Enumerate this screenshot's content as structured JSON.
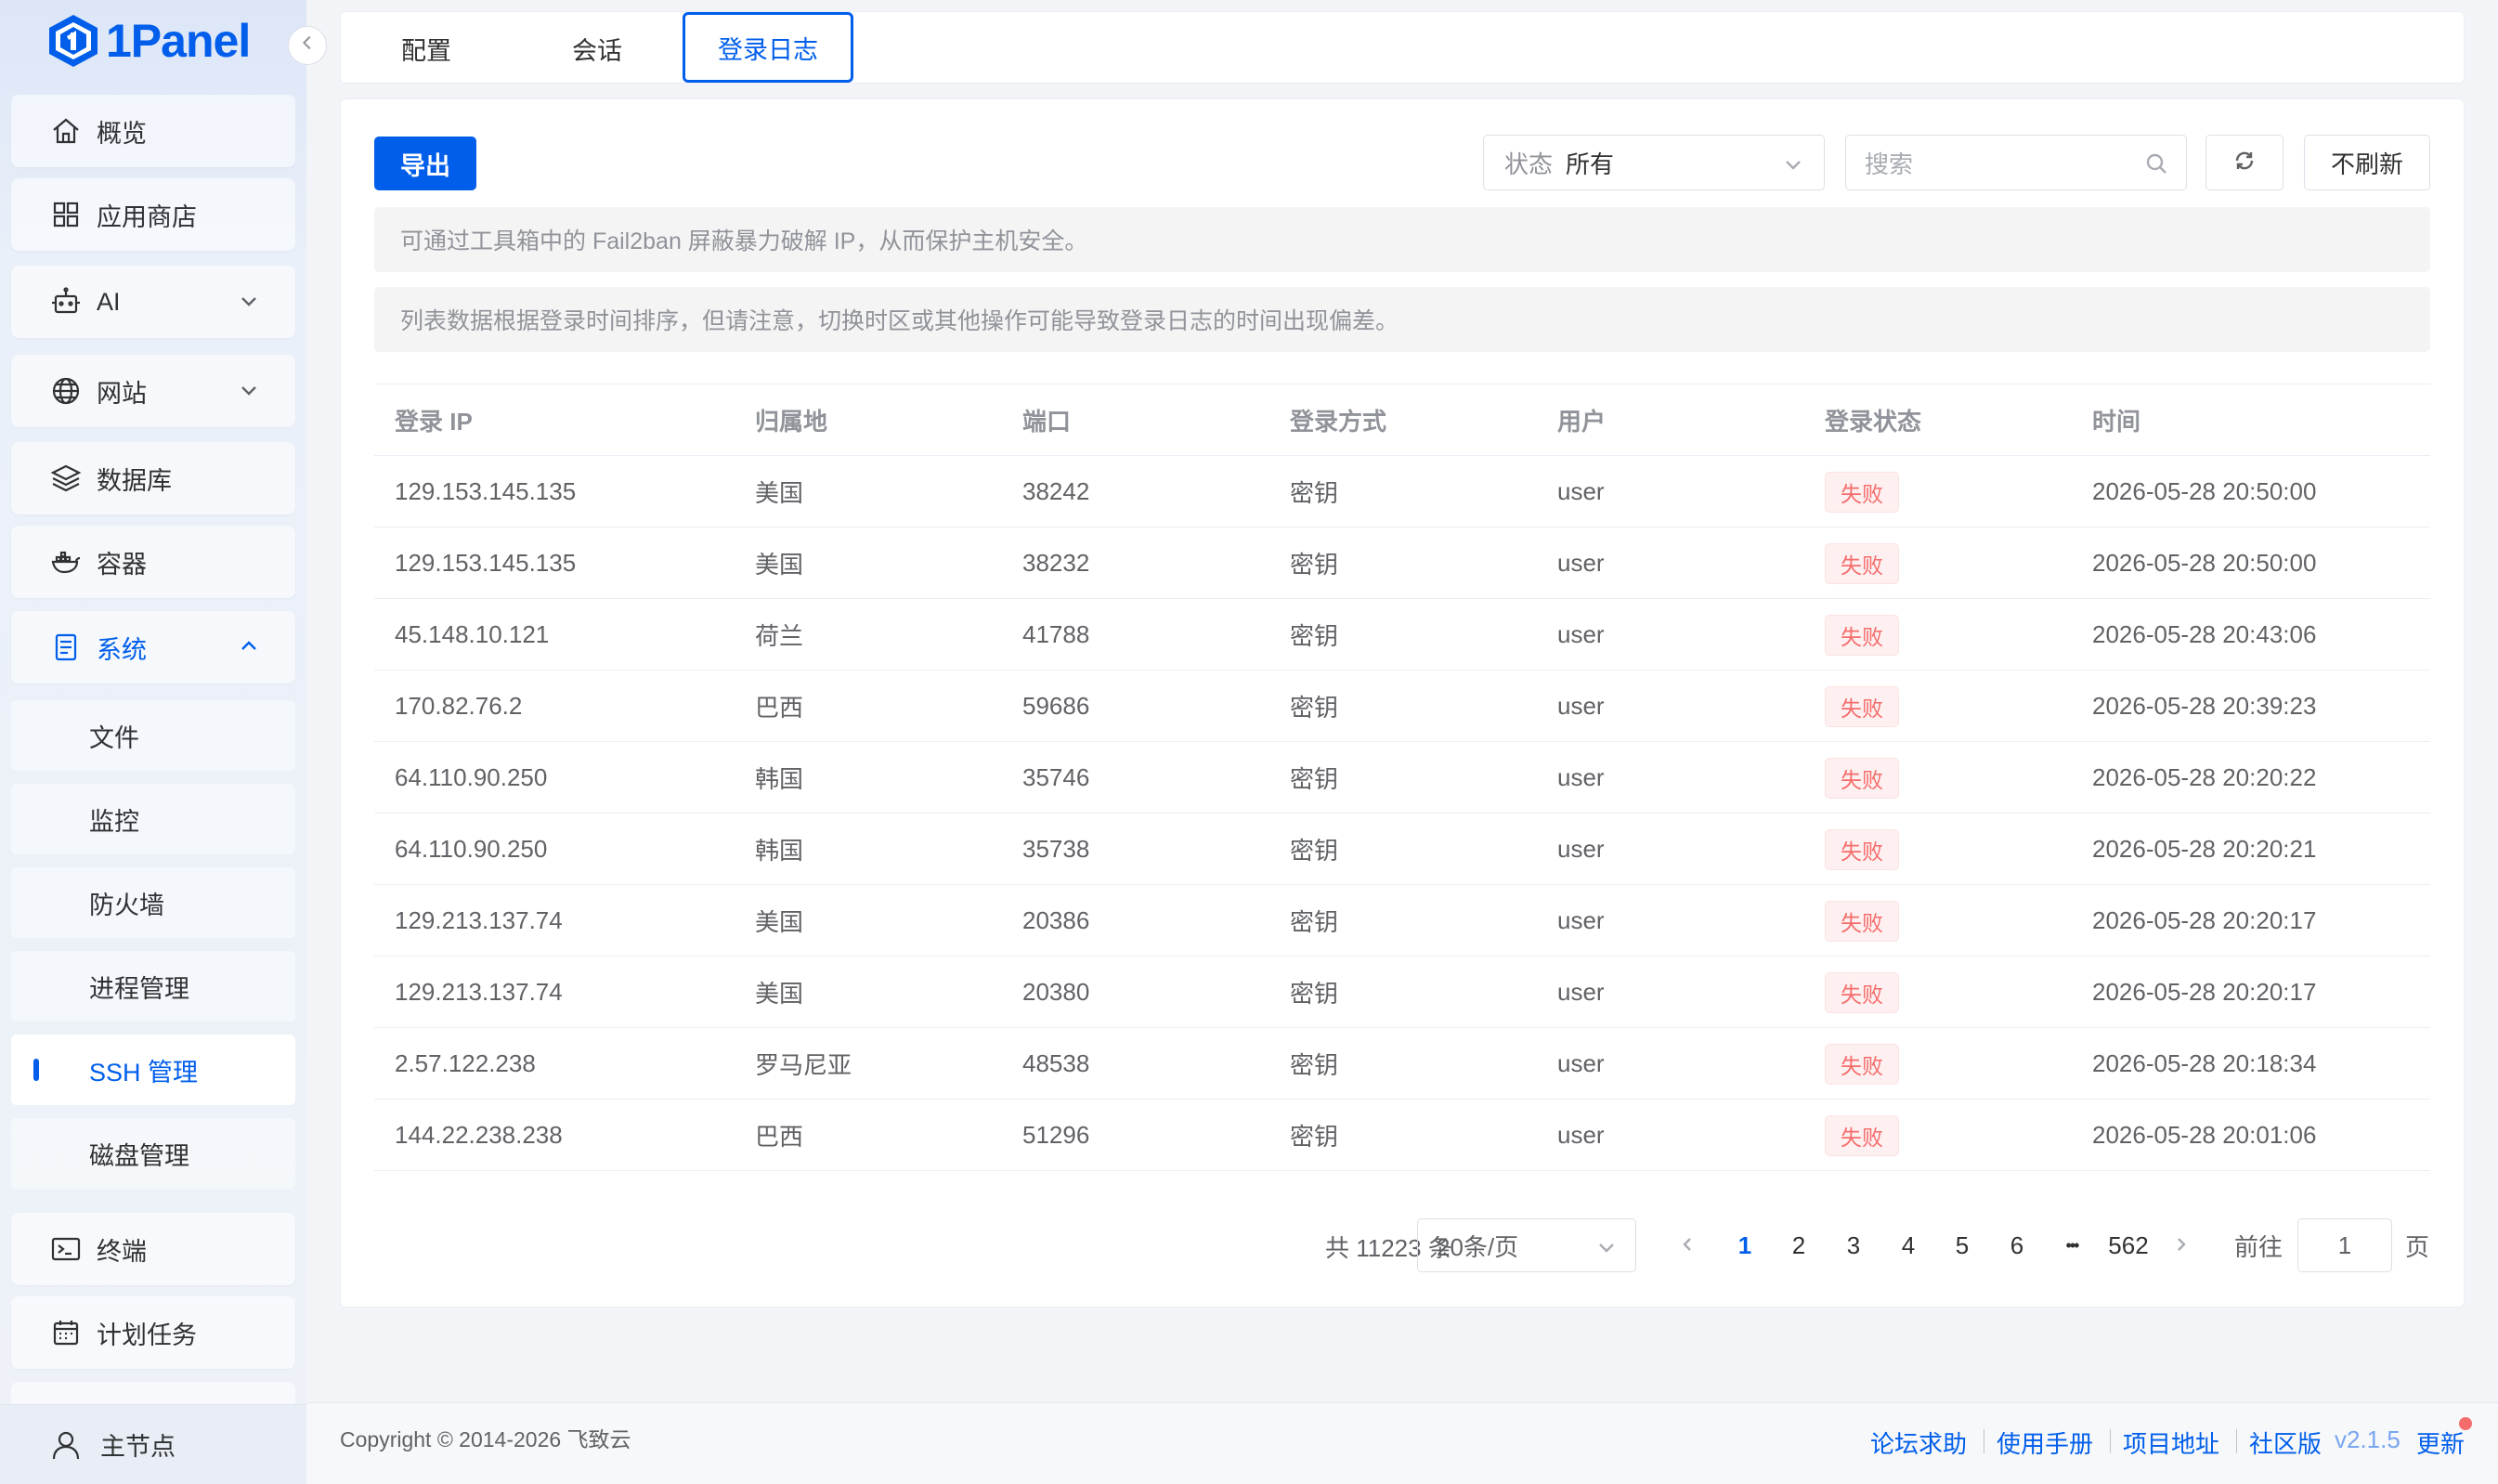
{
  "app": {
    "name": "1Panel"
  },
  "sidebar": {
    "items": [
      {
        "label": "概览",
        "icon": "home-icon"
      },
      {
        "label": "应用商店",
        "icon": "grid-icon"
      },
      {
        "label": "AI",
        "icon": "robot-icon"
      },
      {
        "label": "网站",
        "icon": "globe-icon"
      },
      {
        "label": "数据库",
        "icon": "layers-icon"
      },
      {
        "label": "容器",
        "icon": "docker-icon"
      },
      {
        "label": "系统",
        "icon": "server-icon"
      }
    ],
    "system_sub": [
      "文件",
      "监控",
      "防火墙",
      "进程管理",
      "SSH 管理",
      "磁盘管理"
    ],
    "items_after": [
      {
        "label": "终端",
        "icon": "terminal-icon"
      },
      {
        "label": "计划任务",
        "icon": "calendar-icon"
      }
    ],
    "host": "主节点"
  },
  "tabs": [
    "配置",
    "会话",
    "登录日志"
  ],
  "toolbar": {
    "export_label": "导出",
    "status_label": "状态",
    "status_value": "所有",
    "search_placeholder": "搜索",
    "no_refresh_label": "不刷新"
  },
  "alerts": [
    "可通过工具箱中的 Fail2ban 屏蔽暴力破解 IP，从而保护主机安全。",
    "列表数据根据登录时间排序，但请注意，切换时区或其他操作可能导致登录日志的时间出现偏差。"
  ],
  "table": {
    "columns": [
      "登录 IP",
      "归属地",
      "端口",
      "登录方式",
      "用户",
      "登录状态",
      "时间"
    ],
    "rows": [
      [
        "129.153.145.135",
        "美国",
        "38242",
        "密钥",
        "user",
        "失败",
        "2026-05-28 20:50:00"
      ],
      [
        "129.153.145.135",
        "美国",
        "38232",
        "密钥",
        "user",
        "失败",
        "2026-05-28 20:50:00"
      ],
      [
        "45.148.10.121",
        "荷兰",
        "41788",
        "密钥",
        "user",
        "失败",
        "2026-05-28 20:43:06"
      ],
      [
        "170.82.76.2",
        "巴西",
        "59686",
        "密钥",
        "user",
        "失败",
        "2026-05-28 20:39:23"
      ],
      [
        "64.110.90.250",
        "韩国",
        "35746",
        "密钥",
        "user",
        "失败",
        "2026-05-28 20:20:22"
      ],
      [
        "64.110.90.250",
        "韩国",
        "35738",
        "密钥",
        "user",
        "失败",
        "2026-05-28 20:20:21"
      ],
      [
        "129.213.137.74",
        "美国",
        "20386",
        "密钥",
        "user",
        "失败",
        "2026-05-28 20:20:17"
      ],
      [
        "129.213.137.74",
        "美国",
        "20380",
        "密钥",
        "user",
        "失败",
        "2026-05-28 20:20:17"
      ],
      [
        "2.57.122.238",
        "罗马尼亚",
        "48538",
        "密钥",
        "user",
        "失败",
        "2026-05-28 20:18:34"
      ],
      [
        "144.22.238.238",
        "巴西",
        "51296",
        "密钥",
        "user",
        "失败",
        "2026-05-28 20:01:06"
      ]
    ]
  },
  "pagination": {
    "total": "共 11223 条",
    "page_size": "20条/页",
    "pages": [
      "1",
      "2",
      "3",
      "4",
      "5",
      "6"
    ],
    "ellipsis": "•••",
    "last_page": "562",
    "current": "1",
    "goto_label": "前往",
    "goto_value": "1",
    "goto_suffix": "页"
  },
  "footer": {
    "copyright": "Copyright © 2014-2026 飞致云",
    "links": [
      "论坛求助",
      "使用手册",
      "项目地址",
      "社区版"
    ],
    "version": "v2.1.5",
    "update": "更新"
  },
  "colors": {
    "accent": "#005eeb",
    "danger": "#f56c6c"
  }
}
